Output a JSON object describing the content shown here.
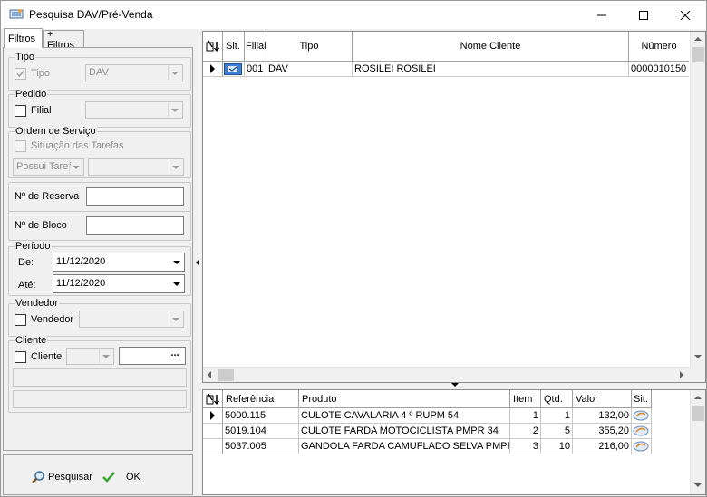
{
  "window": {
    "title": "Pesquisa DAV/Pré-Venda"
  },
  "tabs": [
    {
      "label": "Filtros"
    },
    {
      "label": "+ Filtros"
    }
  ],
  "filters": {
    "tipo": {
      "group": "Tipo",
      "check_label": "Tipo",
      "value": "DAV"
    },
    "pedido": {
      "group": "Pedido",
      "check_label": "Filial",
      "value": ""
    },
    "ordem": {
      "group": "Ordem de Serviço",
      "check_label": "Situação das Tarefas",
      "combo1": "Possui Taref",
      "combo2": ""
    },
    "reserva": {
      "label": "Nº de Reserva",
      "value": ""
    },
    "bloco": {
      "label": "Nº de Bloco",
      "value": ""
    },
    "periodo": {
      "group": "Período",
      "de_label": "De:",
      "de_value": "11/12/2020",
      "ate_label": "Até:",
      "ate_value": "11/12/2020"
    },
    "vendedor": {
      "group": "Vendedor",
      "check_label": "Vendedor",
      "value": ""
    },
    "cliente": {
      "group": "Cliente",
      "check_label": "Cliente",
      "combo_value": "",
      "code_value": "",
      "ellipsis": "...",
      "line1": "",
      "line2": ""
    }
  },
  "actions": {
    "search_label": "Pesquisar",
    "ok_label": "OK"
  },
  "dav_grid": {
    "columns": [
      "Sit.",
      "Filial",
      "Tipo",
      "Nome Cliente",
      "Número"
    ],
    "rows": [
      {
        "status_icon": "dav-status-icon",
        "filial": "001",
        "tipo": "DAV",
        "cliente": "ROSILEI ROSILEI",
        "numero": "0000010150"
      }
    ]
  },
  "items_grid": {
    "columns": [
      "Referência",
      "Produto",
      "Item",
      "Qtd.",
      "Valor",
      "Sit."
    ],
    "rows": [
      {
        "ref": "5000.115",
        "produto": "CULOTE CAVALARIA 4 º RUPM 54",
        "item": "1",
        "qtd": "1",
        "valor": "132,00"
      },
      {
        "ref": "5019.104",
        "produto": "CULOTE FARDA MOTOCICLISTA PMPR 34",
        "item": "2",
        "qtd": "5",
        "valor": "355,20"
      },
      {
        "ref": "5037.005",
        "produto": "GANDOLA FARDA CAMUFLADO SELVA PMPR",
        "item": "3",
        "qtd": "10",
        "valor": "216,00"
      }
    ]
  },
  "colors": {
    "icon_blue": "#3d7fd6",
    "selection": "#0078d7"
  }
}
